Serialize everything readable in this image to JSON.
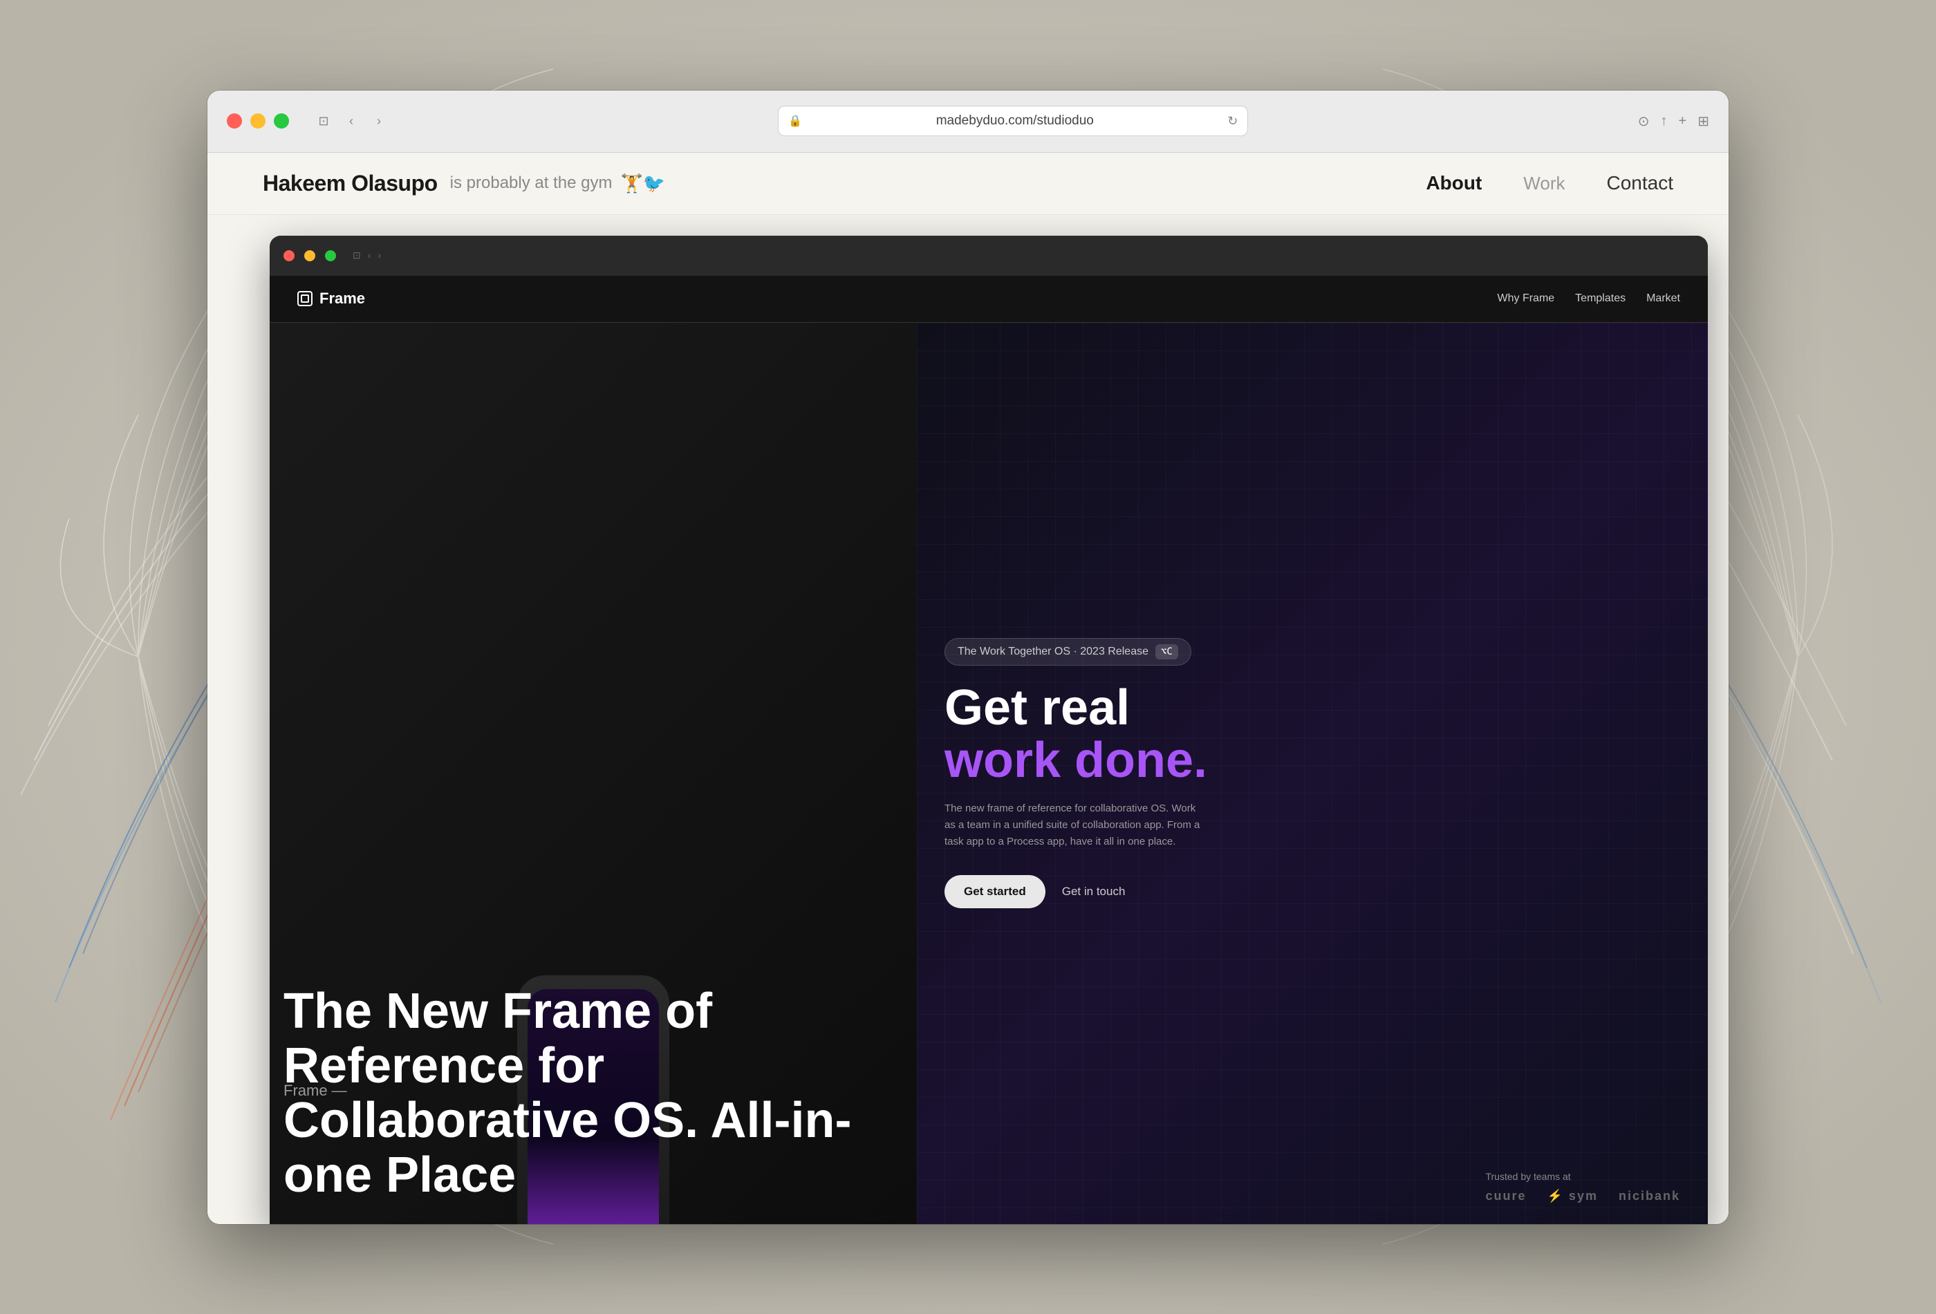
{
  "background": {
    "color": "#c8c4b8"
  },
  "browser": {
    "url": "madebyduo.com/studioduo",
    "traffic_lights": {
      "red": "close",
      "yellow": "minimize",
      "green": "maximize"
    },
    "controls": {
      "back": "‹",
      "forward": "›",
      "sidebar": "⊡"
    },
    "actions": {
      "reader": "⊙",
      "share": "↑",
      "new_tab": "+",
      "tabs": "⊞"
    }
  },
  "site": {
    "name": "Hakeem Olasupo",
    "tagline": "is probably at the gym",
    "emojis": "🏋️🐦",
    "nav": {
      "about": "About",
      "work": "Work",
      "contact": "Contact"
    }
  },
  "frame_website": {
    "logo": "Frame",
    "logo_icon": "□",
    "nav_items": [
      "Why Frame",
      "Templates",
      "Market"
    ],
    "badge": {
      "text": "The Work Together OS · 2023 Release",
      "kbd": "⌥C"
    },
    "hero_title_line1": "Get real",
    "hero_title_line2": "work done.",
    "description": "The new frame of reference for collaborative OS. Work as a team in a unified suite of collaboration app. From a task app  to a Process app, have it all in one place.",
    "cta_primary": "Get started",
    "cta_secondary": "Get in touch",
    "trusted_label": "Trusted by teams at",
    "trusted_logos": [
      "cuure",
      "⚡ sym",
      "nicibank"
    ]
  },
  "overlay": {
    "label": "Frame —",
    "title_line1": "The New Frame of Reference for",
    "title_line2": "Collaborative OS. All-in-one Place"
  }
}
